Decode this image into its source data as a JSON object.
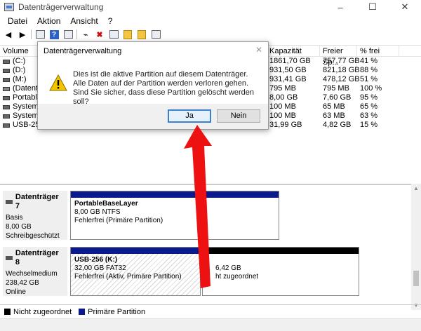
{
  "window": {
    "title": "Datenträgerverwaltung",
    "minimize": "–",
    "maximize": "☐",
    "close": "✕"
  },
  "menu": [
    "Datei",
    "Aktion",
    "Ansicht",
    "?"
  ],
  "list": {
    "headers": {
      "volume": "Volume",
      "capacity": "Kapazität",
      "free": "Freier Sp...",
      "pct": "% frei"
    },
    "rows": [
      {
        "vol": "(C:)",
        "cap": "1861,70 GB",
        "free": "757,77 GB",
        "pct": "41 %"
      },
      {
        "vol": "(D:)",
        "cap": "931,50 GB",
        "free": "821,18 GB",
        "pct": "88 %"
      },
      {
        "vol": "(M:)",
        "cap": "931,41 GB",
        "free": "478,12 GB",
        "pct": "51 %"
      },
      {
        "vol": "(Datenträ",
        "cap": "795 MB",
        "free": "795 MB",
        "pct": "100 %"
      },
      {
        "vol": "PortableB",
        "cap": "8,00 GB",
        "free": "7,60 GB",
        "pct": "95 %"
      },
      {
        "vol": "System-r",
        "cap": "100 MB",
        "free": "65 MB",
        "pct": "65 %"
      },
      {
        "vol": "System-r",
        "cap": "100 MB",
        "free": "63 MB",
        "pct": "63 %"
      },
      {
        "vol": "USB-256",
        "cap": "31,99 GB",
        "free": "4,82 GB",
        "pct": "15 %"
      }
    ]
  },
  "disks": [
    {
      "title": "Datenträger 7",
      "type": "Basis",
      "size": "8,00 GB",
      "status": "Schreibgeschützt",
      "partition": {
        "name": "PortableBaseLayer",
        "size": "8,00 GB NTFS",
        "status": "Fehlerfrei (Primäre Partition)"
      }
    },
    {
      "title": "Datenträger 8",
      "type": "Wechselmedium",
      "size": "238,42 GB",
      "status": "Online",
      "partition": {
        "name": "USB-256 (K:)",
        "size": "32,00 GB FAT32",
        "status": "Fehlerfrei (Aktiv, Primäre Partition)"
      },
      "unallocated": {
        "size": "6,42 GB",
        "status": "ht zugeordnet"
      }
    }
  ],
  "legend": {
    "unallocated": "Nicht zugeordnet",
    "primary": "Primäre Partition"
  },
  "dialog": {
    "title": "Datenträgerverwaltung",
    "message": "Dies ist die aktive Partition auf diesem Datenträger. Alle Daten auf der Partition werden verloren gehen. Sind Sie sicher, dass diese Partition gelöscht werden soll?",
    "yes": "Ja",
    "no": "Nein",
    "close": "✕"
  },
  "colors": {
    "primary_partition": "#0a1a8c",
    "unallocated": "#000000",
    "arrow": "#ee1111"
  }
}
